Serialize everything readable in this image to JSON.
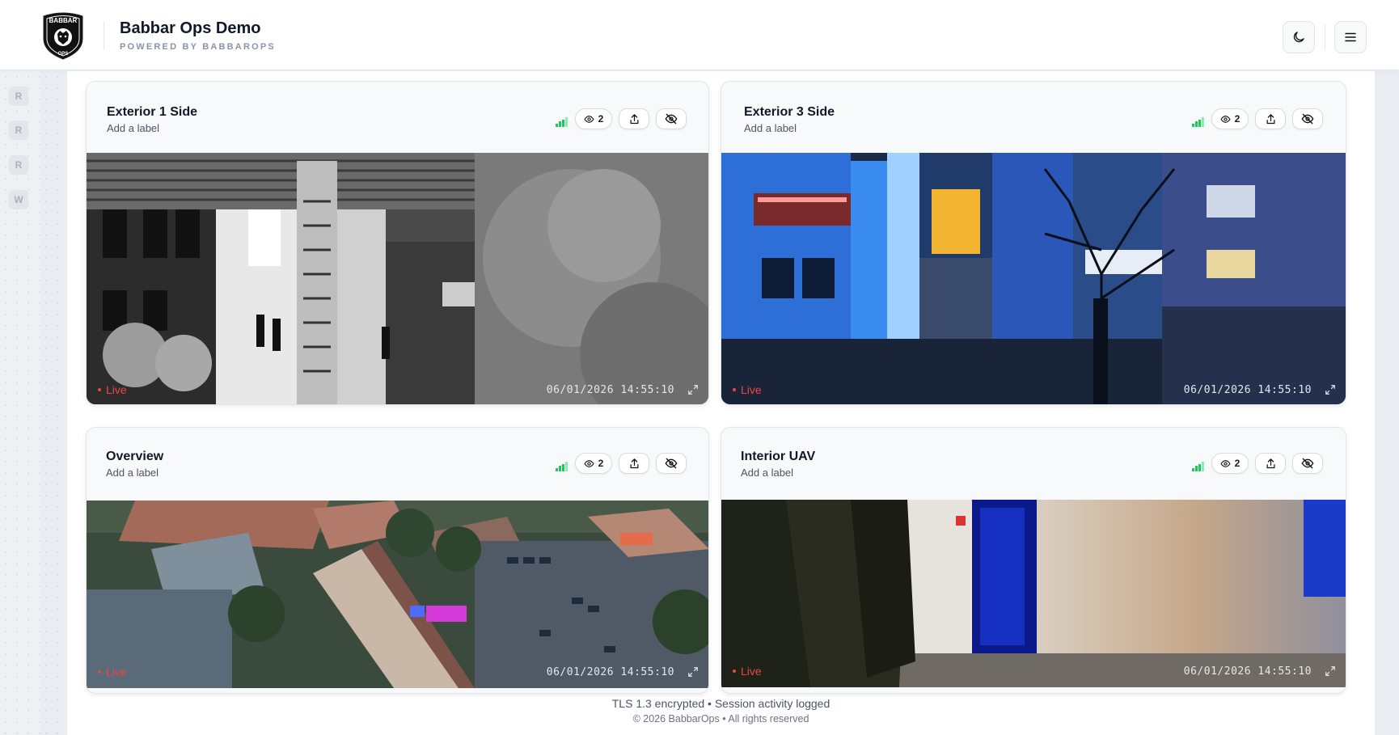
{
  "brand": {
    "title": "Babbar Ops Demo",
    "subtitle": "POWERED BY BABBAROPS",
    "logo_text_top": "BABBAR",
    "logo_text_bottom": "OPS"
  },
  "header": {
    "theme_icon": "moon-icon",
    "menu_icon": "hamburger-icon"
  },
  "rail": {
    "items": [
      {
        "label": "R"
      },
      {
        "label": "R"
      },
      {
        "label": "R"
      },
      {
        "label": "W"
      }
    ]
  },
  "feeds": [
    {
      "title": "Exterior 1 Side",
      "label": "Add a label",
      "viewers": "2",
      "status": "Live",
      "timestamp": "06/01/2026 14:55:10",
      "scene": "thermal"
    },
    {
      "title": "Exterior 3 Side",
      "label": "Add a label",
      "viewers": "2",
      "status": "Live",
      "timestamp": "06/01/2026 14:55:10",
      "scene": "night-building"
    },
    {
      "title": "Overview",
      "label": "Add a label",
      "viewers": "2",
      "status": "Live",
      "timestamp": "06/01/2026 14:55:10",
      "scene": "aerial"
    },
    {
      "title": "Interior UAV",
      "label": "Add a label",
      "viewers": "2",
      "status": "Live",
      "timestamp": "06/01/2026 14:55:10",
      "scene": "interior"
    }
  ],
  "footer": {
    "security": "TLS 1.3 encrypted • Session activity logged",
    "copyright": "© 2026 BabbarOps • All rights reserved"
  },
  "colors": {
    "live": "#ef4444",
    "signal": "#22c55e",
    "accent_dark": "#111827"
  }
}
